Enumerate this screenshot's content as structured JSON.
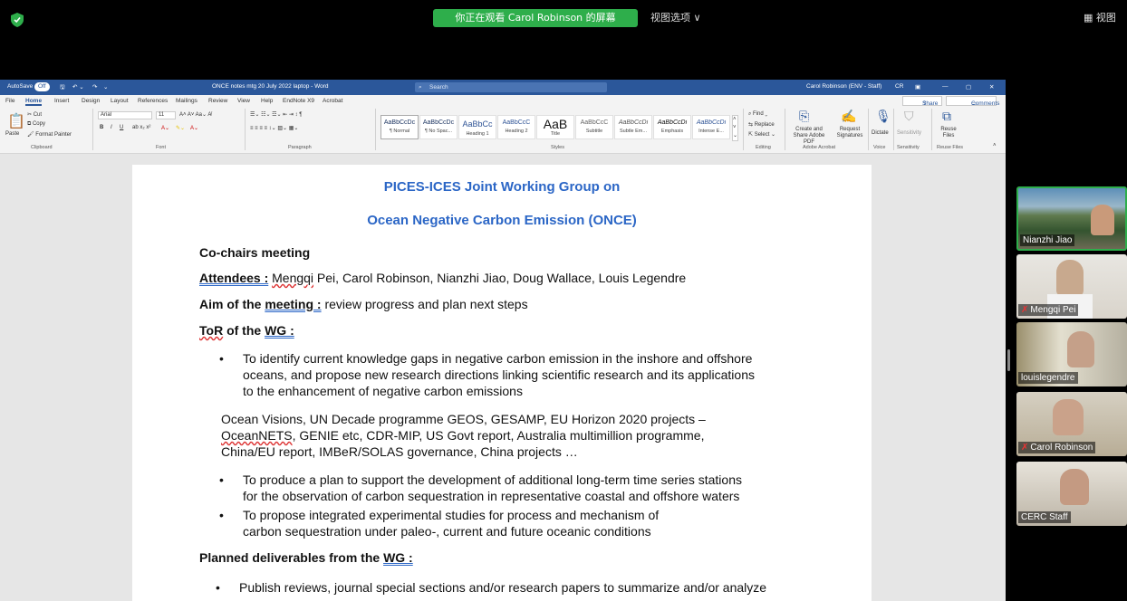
{
  "zoom": {
    "viewing_banner": "你正在观看 Carol Robinson 的屏幕",
    "view_options": "视图选项 ∨",
    "view_button": "视图"
  },
  "word": {
    "titlebar": {
      "autosave": "AutoSave",
      "autosave_state": "Off",
      "doc_title": "ONCE notes mtg 20 July 2022 laptop - Word",
      "search_placeholder": "Search",
      "user": "Carol Robinson (ENV - Staff)",
      "user_initials": "CR"
    },
    "menu": [
      "File",
      "Home",
      "Insert",
      "Design",
      "Layout",
      "References",
      "Mailings",
      "Review",
      "View",
      "Help",
      "EndNote X9",
      "Acrobat"
    ],
    "share": "Share",
    "comments": "Comments",
    "ribbon": {
      "paste": "Paste",
      "cut": "Cut",
      "copy": "Copy",
      "format_painter": "Format Painter",
      "clipboard": "Clipboard",
      "font_name": "Arial",
      "font_size": "11",
      "font": "Font",
      "paragraph": "Paragraph",
      "styles_label": "Styles",
      "styles": [
        {
          "sample": "AaBbCcDc",
          "name": "¶ Normal"
        },
        {
          "sample": "AaBbCcDc",
          "name": "¶ No Spac..."
        },
        {
          "sample": "AaBbCc",
          "name": "Heading 1"
        },
        {
          "sample": "AaBbCcC",
          "name": "Heading 2"
        },
        {
          "sample": "AaB",
          "name": "Title"
        },
        {
          "sample": "AaBbCcC",
          "name": "Subtitle"
        },
        {
          "sample": "AaBbCcDi",
          "name": "Subtle Em..."
        },
        {
          "sample": "AaBbCcDi",
          "name": "Emphasis"
        },
        {
          "sample": "AaBbCcDi",
          "name": "Intense E..."
        }
      ],
      "find": "Find",
      "replace": "Replace",
      "select": "Select",
      "editing": "Editing",
      "create_share_pdf": "Create and Share Adobe PDF",
      "request_signatures": "Request Signatures",
      "adobe_acrobat": "Adobe Acrobat",
      "dictate": "Dictate",
      "voice": "Voice",
      "sensitivity": "Sensitivity",
      "reuse_files": "Reuse Files"
    }
  },
  "document": {
    "title1": "PICES-ICES Joint Working Group on",
    "title2": "Ocean Negative Carbon Emission (ONCE)",
    "cochairs": "Co-chairs meeting",
    "attendees_label": "Attendees :",
    "attendees_first": "Mengqi",
    "attendees_rest": " Pei, Carol Robinson, Nianzhi Jiao, Doug Wallace, Louis Legendre",
    "aim_label_a": "Aim of the ",
    "aim_label_b": "meeting :",
    "aim_text": " review progress and plan next steps",
    "tor_a": "ToR",
    "tor_b": " of the ",
    "tor_c": "WG :",
    "bullet1_l1": "To identify current knowledge gaps in negative carbon emission in the inshore and offshore",
    "bullet1_l2": "oceans, and propose new research directions linking scientific research and its applications",
    "bullet1_l3": "to the enhancement of negative carbon emissions",
    "ov_l1": "Ocean Visions, UN Decade programme GEOS, GESAMP, EU Horizon 2020 projects –",
    "ov_l2a": "OceanNETS",
    "ov_l2b": ", GENIE etc, CDR-MIP, US Govt report, Australia multimillion programme,",
    "ov_l3": "China/EU report, IMBeR/SOLAS governance, China projects …",
    "bullet2_l1": "To produce a plan to support the development of additional long-term time series stations",
    "bullet2_l2": "for the observation of carbon sequestration in representative coastal and offshore waters",
    "bullet3_l1": "To propose integrated experimental studies for process and mechanism of",
    "bullet3_l2": "carbon sequestration under paleo-, current and future oceanic conditions",
    "deliv_a": "Planned deliverables from the ",
    "deliv_b": "WG :",
    "bullet4_l1": "Publish reviews, journal special sections and/or research papers to summarize and/or analyze"
  },
  "participants": [
    {
      "name": "Nianzhi Jiao",
      "muted": false,
      "active": true
    },
    {
      "name": "Mengqi Pei",
      "muted": true,
      "active": false
    },
    {
      "name": "louislegendre",
      "muted": false,
      "active": false
    },
    {
      "name": "Carol Robinson",
      "muted": true,
      "active": false
    },
    {
      "name": "CERC Staff",
      "muted": false,
      "active": false
    }
  ],
  "colors": {
    "word_blue": "#2b579a",
    "zoom_green": "#2eae4b",
    "heading_blue": "#2b66c6"
  }
}
